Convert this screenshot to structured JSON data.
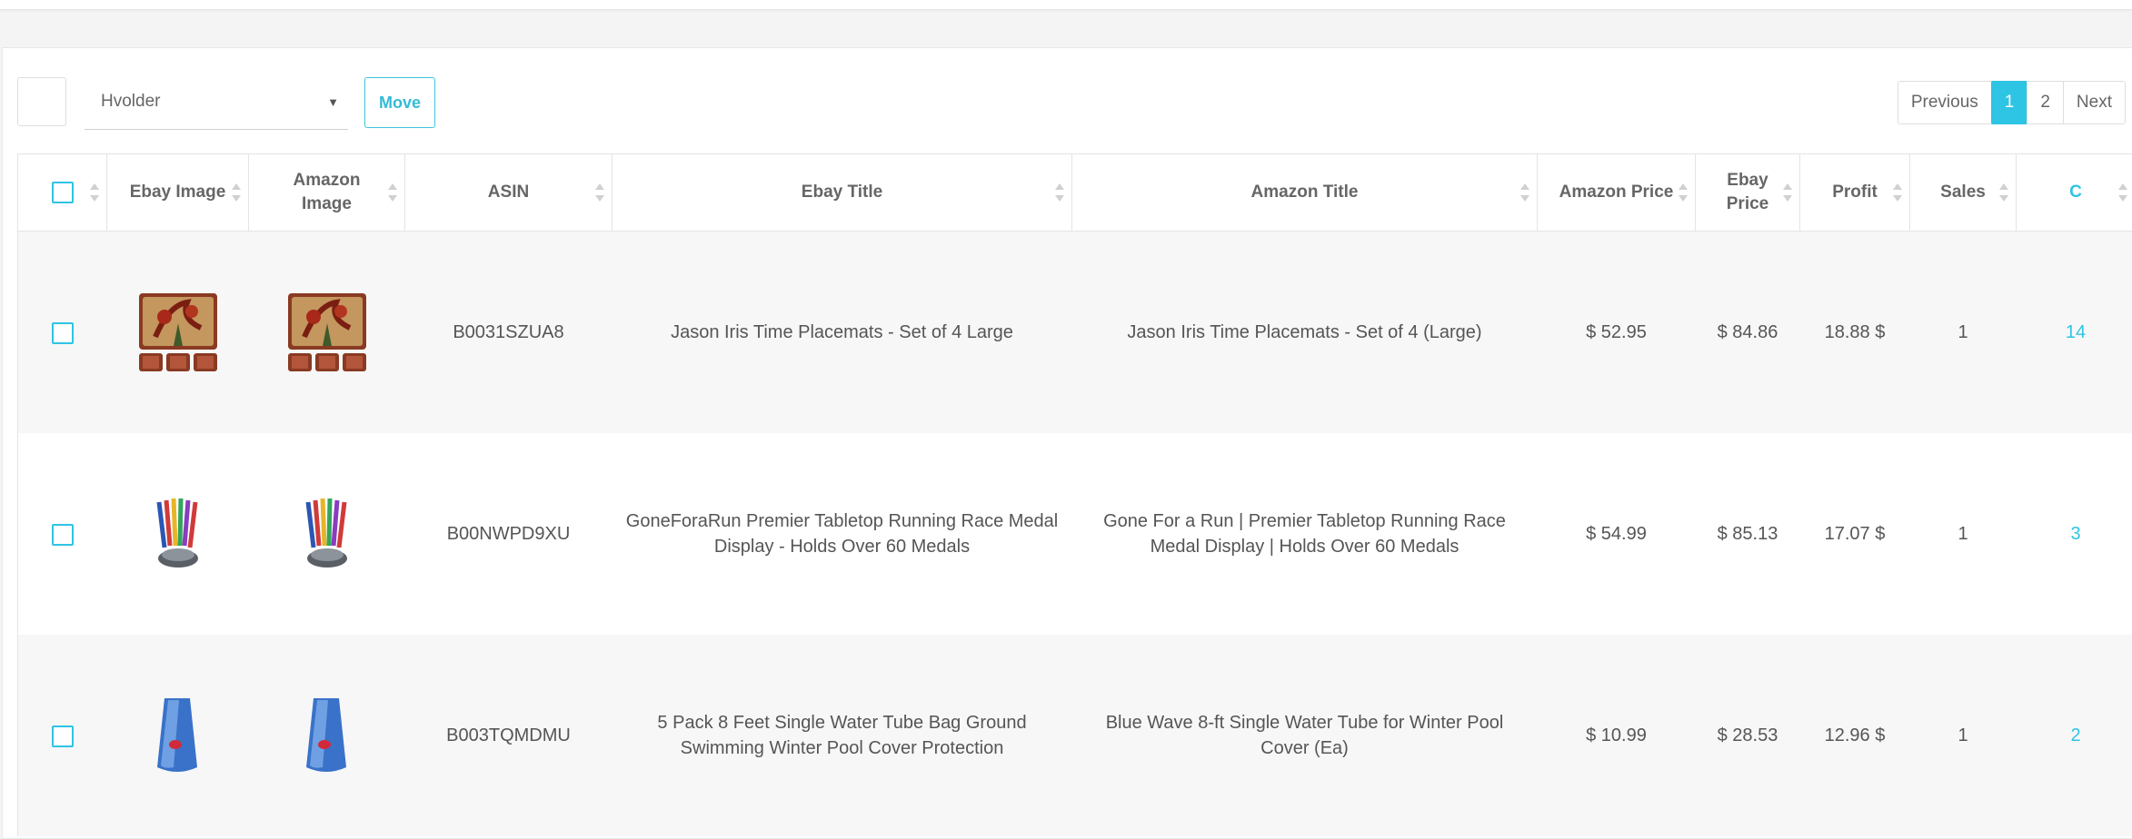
{
  "toolbar": {
    "select_value": "Hvolder",
    "move_label": "Move"
  },
  "pagination": {
    "previous": "Previous",
    "pages": [
      "1",
      "2"
    ],
    "active_page": "1",
    "next": "Next"
  },
  "table": {
    "columns": [
      "Ebay Image",
      "Amazon Image",
      "ASIN",
      "Ebay Title",
      "Amazon Title",
      "Amazon Price",
      "Ebay Price",
      "Profit",
      "Sales",
      "C"
    ],
    "rows": [
      {
        "ebay_image": "placemats-image",
        "amazon_image": "placemats-image",
        "asin": "B0031SZUA8",
        "ebay_title": "Jason Iris Time Placemats - Set of 4 Large",
        "amazon_title": "Jason Iris Time Placemats - Set of 4 (Large)",
        "amazon_price": "$ 52.95",
        "ebay_price": "$ 84.86",
        "profit": "18.88 $",
        "sales": "1",
        "c": "14"
      },
      {
        "ebay_image": "medal-display-image",
        "amazon_image": "medal-display-image",
        "asin": "B00NWPD9XU",
        "ebay_title": "GoneForaRun Premier Tabletop Running Race Medal Display - Holds Over 60 Medals",
        "amazon_title": "Gone For a Run | Premier Tabletop Running Race Medal Display | Holds Over 60 Medals",
        "amazon_price": "$ 54.99",
        "ebay_price": "$ 85.13",
        "profit": "17.07 $",
        "sales": "1",
        "c": "3"
      },
      {
        "ebay_image": "water-tube-image",
        "amazon_image": "water-tube-image",
        "asin": "B003TQMDMU",
        "ebay_title": "5 Pack 8 Feet Single Water Tube Bag Ground Swimming Winter Pool Cover Protection",
        "amazon_title": "Blue Wave 8-ft Single Water Tube for Winter Pool Cover (Ea)",
        "amazon_price": "$ 10.99",
        "ebay_price": "$ 28.53",
        "profit": "12.96 $",
        "sales": "1",
        "c": "2"
      }
    ]
  },
  "colors": {
    "accent": "#2ec4e4",
    "row_alt": "#f7f7f7"
  }
}
